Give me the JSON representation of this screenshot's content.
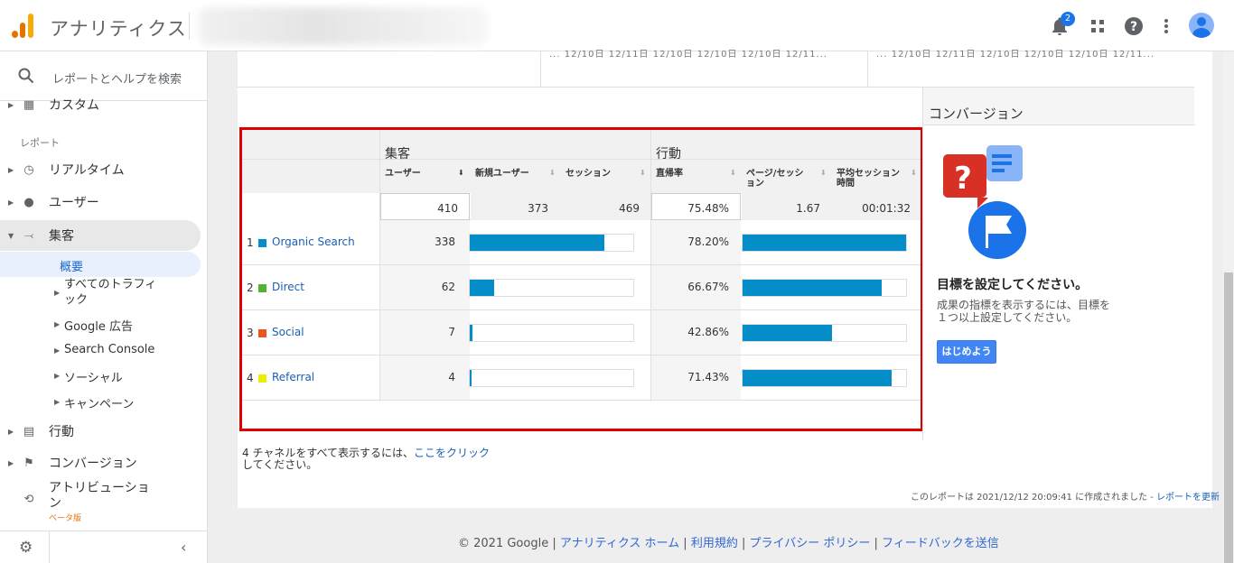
{
  "header": {
    "app_title": "アナリティクス",
    "notifications_count": "2",
    "icons": [
      "bell-icon",
      "apps-grid-icon",
      "help-icon",
      "more-vert-icon",
      "account-avatar"
    ]
  },
  "sidebar": {
    "search_placeholder": "レポートとヘルプを検索",
    "custom_label": "カスタム",
    "reports_section": "レポート",
    "items": [
      {
        "label": "リアルタイム",
        "icon": "clock-icon"
      },
      {
        "label": "ユーザー",
        "icon": "person-icon"
      },
      {
        "label": "集客",
        "icon": "acquisition-icon"
      }
    ],
    "acquisition_sub": {
      "overview": "概要",
      "all_traffic": "すべてのトラフィ\nック",
      "google_ads": "Google 広告",
      "search_console": "Search Console",
      "social": "ソーシャル",
      "campaigns": "キャンペーン"
    },
    "behavior": "行動",
    "conversions": "コンバージョン",
    "attribution": "アトリビューショ\nン",
    "beta": "ベータ版"
  },
  "top_axis": {
    "left": "...      12/10日    12/11日    12/10日    12/10日    12/10日    12/11...",
    "right": "...      12/10日    12/11日    12/10日    12/10日    12/10日    12/11..."
  },
  "table": {
    "group_acquisition": "集客",
    "group_behavior": "行動",
    "headers": {
      "users": "ユーザー",
      "new_users": "新規ユーザー",
      "sessions": "セッション",
      "bounce_rate": "直帰率",
      "pages_per_session": "ページ/セッション",
      "avg_session": "平均セッション時間"
    },
    "totals": {
      "users": "410",
      "new_users": "373",
      "sessions": "469",
      "bounce_rate": "75.48%",
      "pages_per_session": "1.67",
      "avg_session": "00:01:32"
    },
    "rows": [
      {
        "rank": "1",
        "channel": "Organic Search",
        "color": "#058dc7",
        "users": "338",
        "users_pct": 82.4,
        "bounce": "78.20%",
        "bounce_pct": 100
      },
      {
        "rank": "2",
        "channel": "Direct",
        "color": "#50b432",
        "users": "62",
        "users_pct": 15.1,
        "bounce": "66.67%",
        "bounce_pct": 85.3
      },
      {
        "rank": "3",
        "channel": "Social",
        "color": "#ed561b",
        "users": "7",
        "users_pct": 1.7,
        "bounce": "42.86%",
        "bounce_pct": 54.8
      },
      {
        "rank": "4",
        "channel": "Referral",
        "color": "#edef00",
        "users": "4",
        "users_pct": 1.0,
        "bounce": "71.43%",
        "bounce_pct": 91.3
      }
    ]
  },
  "conversion_panel": {
    "title": "コンバージョン",
    "heading": "目標を設定してください。",
    "description": "成果の指標を表示するには、目標を１つ以上設定してください。",
    "button": "はじめよう"
  },
  "note": {
    "text_before": "4 チャネルをすべて表示するには、",
    "link": "ここをクリック",
    "text_after": "してください。"
  },
  "report_stamp": {
    "text": "このレポートは 2021/12/12 20:09:41 に作成されました - ",
    "link": "レポートを更新"
  },
  "footer": {
    "copyright": "© 2021 Google",
    "links": [
      "アナリティクス ホーム",
      "利用規約",
      "プライバシー ポリシー",
      "フィードバックを送信"
    ]
  }
}
